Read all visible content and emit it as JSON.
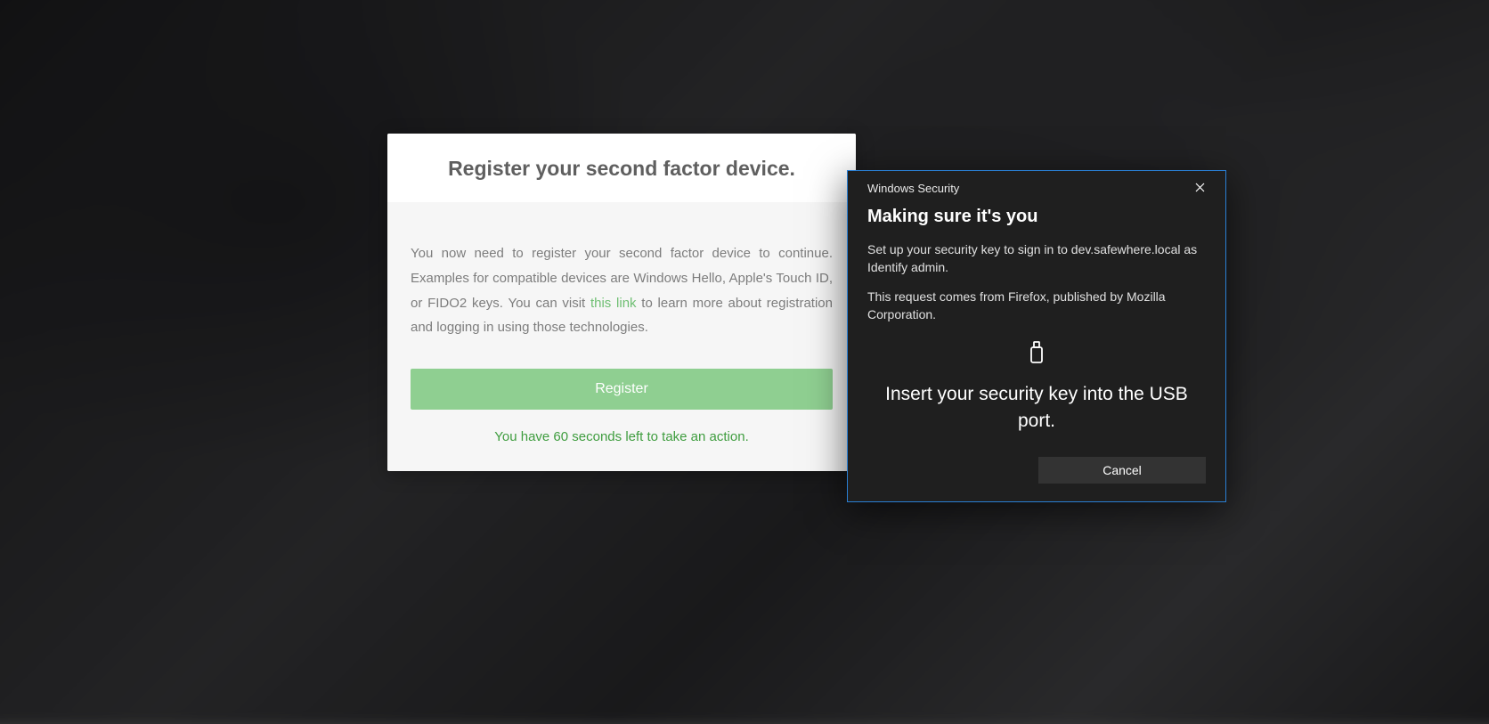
{
  "card": {
    "title": "Register your second factor device.",
    "desc_before": "You now need to register your second factor device to continue. Examples for compatible devices are Windows Hello, Apple's Touch ID, or FIDO2 keys. You can visit ",
    "link_text": "this link",
    "desc_after": " to learn more about registration and logging in using those technologies.",
    "register_label": "Register",
    "countdown_text": "You have 60 seconds left to take an action."
  },
  "win": {
    "header_title": "Windows Security",
    "heading": "Making sure it's you",
    "text1": "Set up your security key to sign in to dev.safewhere.local as Identify admin.",
    "text2": "This request comes from Firefox, published by Mozilla Corporation.",
    "instruction": "Insert your security key into the USB port.",
    "cancel_label": "Cancel"
  }
}
